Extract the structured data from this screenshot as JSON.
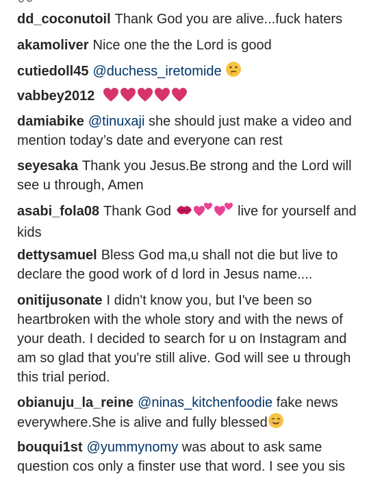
{
  "colors": {
    "text": "#262626",
    "mention": "#003569",
    "heart": "#d6336c",
    "emoji_face": "#f7c443"
  },
  "comments": [
    {
      "user": "dd_coconutoil",
      "text": "Thank God you are alive...fuck haters"
    },
    {
      "user": "akamoliver",
      "text": "Nice one the the Lord is good"
    },
    {
      "user": "cutiedoll45",
      "mention": "@duchess_iretomide",
      "emoji": "thinking-face-icon"
    },
    {
      "user": "vabbey2012",
      "emoji": "heart-icon x5"
    },
    {
      "user": "damiabike",
      "mention": "@tinuxaji",
      "text": "she should just make a video and mention today’s date and everyone can rest"
    },
    {
      "user": "seyesaka",
      "text": "Thank you Jesus.Be strong and the Lord will see u through, Amen"
    },
    {
      "user": "asabi_fola08",
      "text_before": "Thank God",
      "text_after": "live for yourself and kids"
    },
    {
      "user": "dettysamuel",
      "text": "Bless God ma,u shall not die but live to declare the good work of d lord in Jesus name...."
    },
    {
      "user": "onitijusonate",
      "text": "I didn't know you, but I've been so heartbroken with the whole story and with the news of your death. I decided to search for u on Instagram and am so glad that you're still alive. God will see u through this trial period."
    },
    {
      "user": "obianuju_la_reine",
      "mention": "@ninas_kitchenfoodie",
      "text": "fake news everywhere.She is alive and fully blessed"
    },
    {
      "user": "bouqui1st",
      "mention": "@yummynomy",
      "text": "was about to ask same question cos only a finster use that word. I see you sis"
    }
  ]
}
